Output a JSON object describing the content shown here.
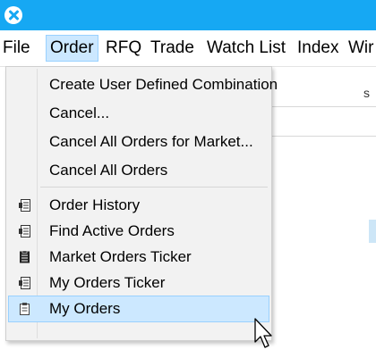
{
  "menubar": {
    "items": [
      {
        "label": "File"
      },
      {
        "label": "Order"
      },
      {
        "label": "RFQ"
      },
      {
        "label": "Trade"
      },
      {
        "label": "Watch List"
      },
      {
        "label": "Index"
      },
      {
        "label": "Wir"
      }
    ]
  },
  "background": {
    "fragment": "s"
  },
  "order_menu": {
    "items": [
      {
        "label": "Create User Defined Combination",
        "icon": ""
      },
      {
        "label": "Cancel...",
        "icon": ""
      },
      {
        "label": "Cancel All Orders for Market...",
        "icon": ""
      },
      {
        "label": "Cancel All Orders",
        "icon": ""
      },
      {
        "label": "Order History",
        "icon": "orders-list-icon"
      },
      {
        "label": "Find Active Orders",
        "icon": "orders-list-icon"
      },
      {
        "label": "Market Orders Ticker",
        "icon": "market-ticker-icon"
      },
      {
        "label": "My Orders Ticker",
        "icon": "orders-list-icon"
      },
      {
        "label": "My Orders",
        "icon": "clipboard-icon"
      }
    ],
    "highlighted_item": "My Orders"
  },
  "colors": {
    "titlebar": "#16a8f3",
    "menu_highlight": "#cce8ff",
    "menu_highlight_border": "#99d1ff",
    "menu_background": "#f2f2f2"
  }
}
